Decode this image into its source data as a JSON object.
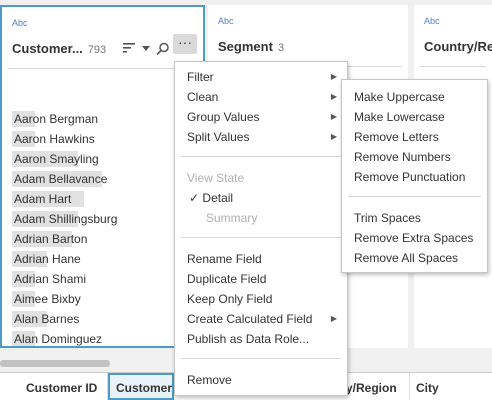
{
  "cards": [
    {
      "abc": "Abc",
      "title": "Customer...",
      "count": "793"
    },
    {
      "abc": "Abc",
      "title": "Segment",
      "count": "3"
    },
    {
      "abc": "Abc",
      "title": "Country/Regi",
      "count": ""
    }
  ],
  "values": [
    {
      "label": "Aaron Bergman",
      "fill": 0.15
    },
    {
      "label": "Aaron Hawkins",
      "fill": 0.15
    },
    {
      "label": "Aaron Smayling",
      "fill": 0.44
    },
    {
      "label": "Adam Bellavance",
      "fill": 0.6
    },
    {
      "label": "Adam Hart",
      "fill": 0.48
    },
    {
      "label": "Adam Shillingsburg",
      "fill": 0.44
    },
    {
      "label": "Adrian Barton",
      "fill": 0.4
    },
    {
      "label": "Adrian Hane",
      "fill": 0.23
    },
    {
      "label": "Adrian Shami",
      "fill": 0.15
    },
    {
      "label": "Aimee Bixby",
      "fill": 0.15
    },
    {
      "label": "Alan Barnes",
      "fill": 0.23
    },
    {
      "label": "Alan Dominguez",
      "fill": 0.15
    }
  ],
  "menu": {
    "filter": "Filter",
    "clean": "Clean",
    "group_values": "Group Values",
    "split_values": "Split Values",
    "view_state": "View State",
    "detail_check": "✓",
    "detail": "Detail",
    "summary": "Summary",
    "rename": "Rename Field",
    "duplicate": "Duplicate Field",
    "keep_only": "Keep Only Field",
    "create_calc": "Create Calculated Field",
    "publish": "Publish as Data Role...",
    "remove": "Remove"
  },
  "submenu": {
    "uppercase": "Make Uppercase",
    "lowercase": "Make Lowercase",
    "remove_letters": "Remove Letters",
    "remove_numbers": "Remove Numbers",
    "remove_punctuation": "Remove Punctuation",
    "trim_spaces": "Trim Spaces",
    "remove_extra_spaces": "Remove Extra Spaces",
    "remove_all_spaces": "Remove All Spaces"
  },
  "bottom_columns": [
    "Customer ID",
    "Customer",
    "y/Region",
    "City"
  ],
  "colors": {
    "accent": "#4e9ac6",
    "abc": "#4e7fc0"
  }
}
